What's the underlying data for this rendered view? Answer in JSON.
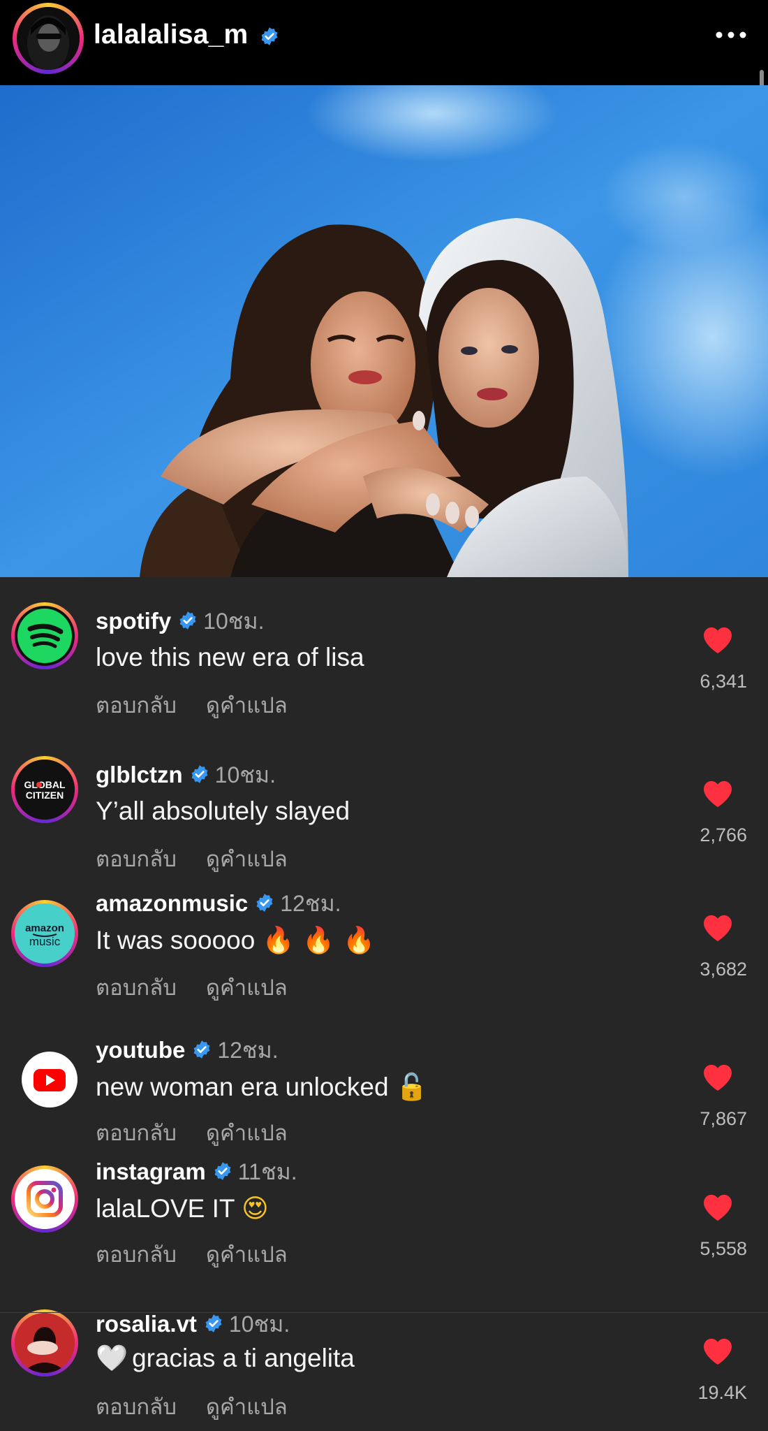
{
  "header": {
    "username": "lalalalisa_m",
    "verified": true,
    "more_icon": "more-horizontal-icon"
  },
  "post": {
    "image": "photo of two women embracing against a blue sky background"
  },
  "comments": [
    {
      "username": "spotify",
      "time": "10ชม.",
      "text": "love this new era of lisa",
      "emoji": "",
      "reply_label": "ตอบกลับ",
      "translate_label": "ดูคำแปล",
      "likes": "6,341",
      "avatar_icon": "spotify-logo-icon"
    },
    {
      "username": "glblctzn",
      "time": "10ชม.",
      "text": "Y’all absolutely slayed",
      "emoji": "",
      "reply_label": "ตอบกลับ",
      "translate_label": "ดูคำแปล",
      "likes": "2,766",
      "avatar_icon": "global-citizen-logo-icon",
      "avatar_text": "GLOBAL CITIZEN"
    },
    {
      "username": "amazonmusic",
      "time": "12ชม.",
      "text": "It was sooooo ",
      "emoji": "🔥 🔥 🔥",
      "reply_label": "ตอบกลับ",
      "translate_label": "ดูคำแปล",
      "likes": "3,682",
      "avatar_icon": "amazon-music-logo-icon",
      "avatar_text_1": "amazon",
      "avatar_text_2": "music"
    },
    {
      "username": "youtube",
      "time": "12ชม.",
      "text": "new woman era unlocked ",
      "emoji": "🔓",
      "reply_label": "ตอบกลับ",
      "translate_label": "ดูคำแปล",
      "likes": "7,867",
      "avatar_icon": "youtube-logo-icon"
    },
    {
      "username": "instagram",
      "time": "11ชม.",
      "text": "lalaLOVE IT ",
      "emoji": "😍",
      "reply_label": "ตอบกลับ",
      "translate_label": "ดูคำแปล",
      "likes": "5,558",
      "avatar_icon": "instagram-logo-icon"
    },
    {
      "username": "rosalia.vt",
      "time": "10ชม.",
      "text": "gracias a ti angelita",
      "emoji": "🤍",
      "reply_label": "ตอบกลับ",
      "translate_label": "ดูคำแปล",
      "likes": "19.4K",
      "avatar_icon": "rosalia-avatar"
    }
  ],
  "colors": {
    "background": "#262626",
    "header": "#000000",
    "verified": "#3897f0",
    "like": "#ff3040",
    "secondary_text": "#a8a8a8"
  }
}
